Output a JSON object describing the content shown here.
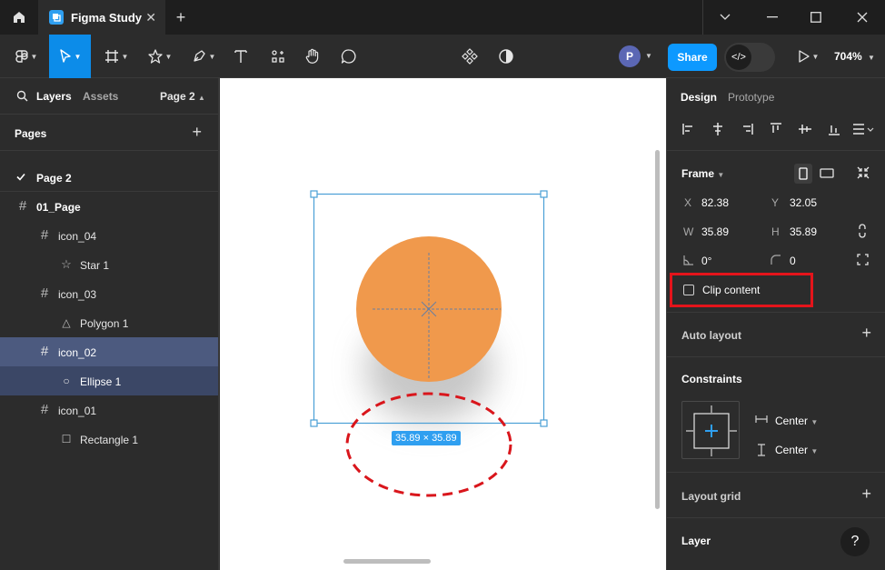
{
  "window": {
    "tab_title": "Figma Study"
  },
  "toolbar": {
    "avatar_initial": "P",
    "share_label": "Share",
    "devmode_icon": "</>",
    "zoom": "704%"
  },
  "left_panel": {
    "tabs": {
      "layers": "Layers",
      "assets": "Assets",
      "page": "Page 2"
    },
    "pages_title": "Pages",
    "current_page": "Page 2",
    "layers": [
      {
        "label": "01_Page",
        "icon": "frame-icon"
      },
      {
        "label": "icon_04",
        "icon": "frame-icon"
      },
      {
        "label": "Star 1",
        "icon": "star-icon"
      },
      {
        "label": "icon_03",
        "icon": "frame-icon"
      },
      {
        "label": "Polygon 1",
        "icon": "triangle-icon"
      },
      {
        "label": "icon_02",
        "icon": "frame-icon",
        "selected": true
      },
      {
        "label": "Ellipse 1",
        "icon": "ellipse-icon"
      },
      {
        "label": "icon_01",
        "icon": "frame-icon"
      },
      {
        "label": "Rectangle 1",
        "icon": "rectangle-icon"
      }
    ]
  },
  "canvas": {
    "size_badge": "35.89 × 35.89",
    "ellipse_color": "#f0994c",
    "selection_color": "#4a9fd6",
    "annotation_color": "#d9161c"
  },
  "right_panel": {
    "tabs": {
      "design": "Design",
      "prototype": "Prototype"
    },
    "frame_title": "Frame",
    "x_label": "X",
    "x": "82.38",
    "y_label": "Y",
    "y": "32.05",
    "w_label": "W",
    "w": "35.89",
    "h_label": "H",
    "h": "35.89",
    "rotation": "0°",
    "radius": "0",
    "clip_content": "Clip content",
    "auto_layout": "Auto layout",
    "constraints": "Constraints",
    "constraint_h": "Center",
    "constraint_v": "Center",
    "layout_grid": "Layout grid",
    "layer": "Layer",
    "help": "?"
  }
}
